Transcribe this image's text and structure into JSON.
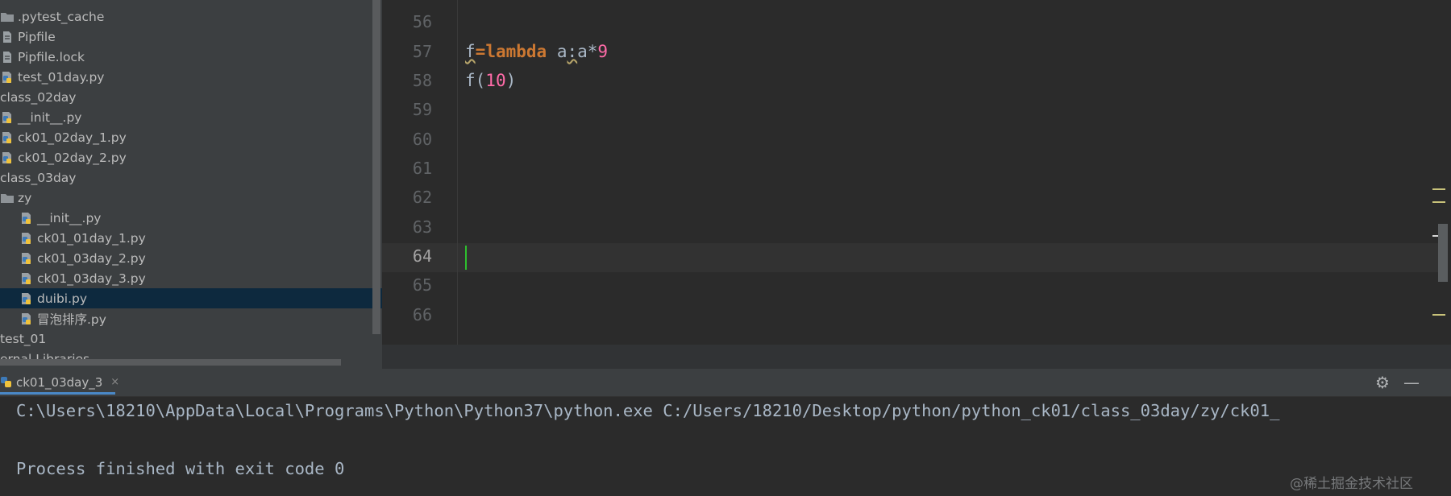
{
  "project_tree": {
    "items": [
      {
        "label": ".pytest_cache",
        "type": "folder",
        "indent": 0
      },
      {
        "label": "Pipfile",
        "type": "file",
        "indent": 0
      },
      {
        "label": "Pipfile.lock",
        "type": "file",
        "indent": 0
      },
      {
        "label": "test_01day.py",
        "type": "python",
        "indent": 0
      },
      {
        "label": "class_02day",
        "type": "text",
        "indent": 0
      },
      {
        "label": "__init__.py",
        "type": "python",
        "indent": 0
      },
      {
        "label": "ck01_02day_1.py",
        "type": "python",
        "indent": 0
      },
      {
        "label": "ck01_02day_2.py",
        "type": "python",
        "indent": 0
      },
      {
        "label": "class_03day",
        "type": "text",
        "indent": 0
      },
      {
        "label": "zy",
        "type": "folder",
        "indent": 0
      },
      {
        "label": "__init__.py",
        "type": "python",
        "indent": 1
      },
      {
        "label": "ck01_01day_1.py",
        "type": "python",
        "indent": 1
      },
      {
        "label": "ck01_03day_2.py",
        "type": "python",
        "indent": 1
      },
      {
        "label": "ck01_03day_3.py",
        "type": "python",
        "indent": 1
      },
      {
        "label": "duibi.py",
        "type": "python",
        "indent": 1,
        "selected": true
      },
      {
        "label": "冒泡排序.py",
        "type": "python",
        "indent": 1
      },
      {
        "label": "test_01",
        "type": "text",
        "indent": 0
      },
      {
        "label": "ernal Libraries",
        "type": "text",
        "indent": 0
      }
    ]
  },
  "editor": {
    "line_numbers": [
      "56",
      "57",
      "58",
      "59",
      "60",
      "61",
      "62",
      "63",
      "64",
      "65",
      "66"
    ],
    "current_line": "64",
    "code": {
      "line57": {
        "var": "f",
        "op": "=",
        "kw": "lambda",
        "param": " a",
        "colon": ":",
        "body": "a*",
        "num": "9"
      },
      "line58": {
        "call": "f(",
        "num": "10",
        "close": ")"
      }
    }
  },
  "run_panel": {
    "tab_label": "ck01_03day_3",
    "tab_close": "×",
    "console_lines": [
      "C:\\Users\\18210\\AppData\\Local\\Programs\\Python\\Python37\\python.exe C:/Users/18210/Desktop/python/python_ck01/class_03day/zy/ck01_",
      "",
      "Process finished with exit code 0"
    ]
  },
  "icons": {
    "settings": "gear-icon",
    "minimize": "minimize-icon",
    "python_file": "python-file-icon",
    "folder": "folder-icon",
    "file": "file-icon"
  },
  "colors": {
    "keyword": "#cc7832",
    "number": "#ff6ba8",
    "caret": "#2ec02e",
    "selection": "#0d293e"
  },
  "watermark": "@稀土掘金技术社区"
}
